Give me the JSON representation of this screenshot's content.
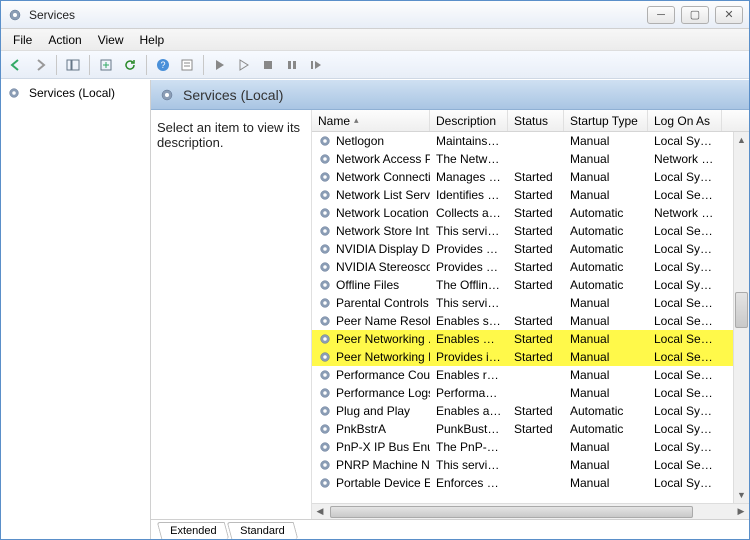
{
  "window": {
    "title": "Services"
  },
  "menus": [
    "File",
    "Action",
    "View",
    "Help"
  ],
  "tree": {
    "root": "Services (Local)"
  },
  "header": {
    "title": "Services (Local)"
  },
  "desc_pane": "Select an item to view its description.",
  "columns": [
    "Name",
    "Description",
    "Status",
    "Startup Type",
    "Log On As"
  ],
  "tabs": [
    "Extended",
    "Standard"
  ],
  "services": [
    {
      "name": "Netlogon",
      "desc": "Maintains a ...",
      "status": "",
      "startup": "Manual",
      "logon": "Local Syste...",
      "hl": false
    },
    {
      "name": "Network Access P...",
      "desc": "The Networ...",
      "status": "",
      "startup": "Manual",
      "logon": "Network S...",
      "hl": false
    },
    {
      "name": "Network Connecti...",
      "desc": "Manages o...",
      "status": "Started",
      "startup": "Manual",
      "logon": "Local Syste...",
      "hl": false
    },
    {
      "name": "Network List Service",
      "desc": "Identifies th...",
      "status": "Started",
      "startup": "Manual",
      "logon": "Local Service",
      "hl": false
    },
    {
      "name": "Network Location ...",
      "desc": "Collects an...",
      "status": "Started",
      "startup": "Automatic",
      "logon": "Network S...",
      "hl": false
    },
    {
      "name": "Network Store Int...",
      "desc": "This service ...",
      "status": "Started",
      "startup": "Automatic",
      "logon": "Local Service",
      "hl": false
    },
    {
      "name": "NVIDIA Display Dri...",
      "desc": "Provides sys...",
      "status": "Started",
      "startup": "Automatic",
      "logon": "Local Syste...",
      "hl": false
    },
    {
      "name": "NVIDIA Stereosco...",
      "desc": "Provides sys...",
      "status": "Started",
      "startup": "Automatic",
      "logon": "Local Syste...",
      "hl": false
    },
    {
      "name": "Offline Files",
      "desc": "The Offline ...",
      "status": "Started",
      "startup": "Automatic",
      "logon": "Local Syste...",
      "hl": false
    },
    {
      "name": "Parental Controls",
      "desc": "This service ...",
      "status": "",
      "startup": "Manual",
      "logon": "Local Service",
      "hl": false
    },
    {
      "name": "Peer Name Resolu...",
      "desc": "Enables serv...",
      "status": "Started",
      "startup": "Manual",
      "logon": "Local Service",
      "hl": false
    },
    {
      "name": "Peer Networking ...",
      "desc": "Enables mul...",
      "status": "Started",
      "startup": "Manual",
      "logon": "Local Service",
      "hl": true
    },
    {
      "name": "Peer Networking I...",
      "desc": "Provides ide...",
      "status": "Started",
      "startup": "Manual",
      "logon": "Local Service",
      "hl": true
    },
    {
      "name": "Performance Cou...",
      "desc": "Enables rem...",
      "status": "",
      "startup": "Manual",
      "logon": "Local Service",
      "hl": false
    },
    {
      "name": "Performance Logs...",
      "desc": "Performanc...",
      "status": "",
      "startup": "Manual",
      "logon": "Local Service",
      "hl": false
    },
    {
      "name": "Plug and Play",
      "desc": "Enables a c...",
      "status": "Started",
      "startup": "Automatic",
      "logon": "Local Syste...",
      "hl": false
    },
    {
      "name": "PnkBstrA",
      "desc": "PunkBuster ...",
      "status": "Started",
      "startup": "Automatic",
      "logon": "Local Syste...",
      "hl": false
    },
    {
      "name": "PnP-X IP Bus Enu...",
      "desc": "The PnP-X ...",
      "status": "",
      "startup": "Manual",
      "logon": "Local Syste...",
      "hl": false
    },
    {
      "name": "PNRP Machine Na...",
      "desc": "This service ...",
      "status": "",
      "startup": "Manual",
      "logon": "Local Service",
      "hl": false
    },
    {
      "name": "Portable Device E...",
      "desc": "Enforces gr...",
      "status": "",
      "startup": "Manual",
      "logon": "Local Syste...",
      "hl": false
    }
  ]
}
